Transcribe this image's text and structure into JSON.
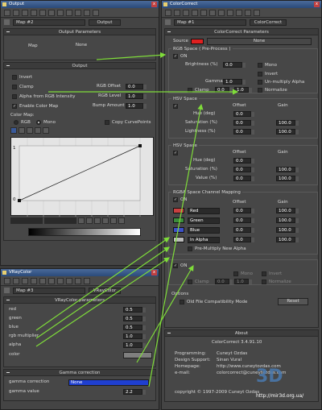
{
  "left_window": {
    "title": "Output",
    "map_name": "Map #2",
    "map_type": "Output",
    "output_params_title": "Output Parameters",
    "map_label": "Map",
    "map_value": "None",
    "output_title": "Output",
    "invert_label": "Invert",
    "clamp_label": "Clamp",
    "alpha_rgb_label": "Alpha from RGB Intensity",
    "enable_color_map_label": "Enable Color Map",
    "rgb_offset_label": "RGB Offset",
    "rgb_offset_value": "0.0",
    "rgb_level_label": "RGB Level",
    "rgb_level_value": "1.0",
    "bump_amount_label": "Bump Amount",
    "bump_amount_value": "1.0",
    "color_map_label": "Color Map:",
    "rgb_radio_label": "RGB",
    "mono_radio_label": "Mono",
    "copy_curve_label": "Copy CurvePoints",
    "curve_y_top": "1",
    "curve_y_bottom": "0"
  },
  "vray_window": {
    "title": "VRayColor",
    "map_name": "Map #3",
    "map_type": "VRayColor",
    "params_title": "VRayColor parameters",
    "red_label": "red",
    "red_value": "0.5",
    "green_label": "green",
    "green_value": "0.5",
    "blue_label": "blue",
    "blue_value": "0.5",
    "rgb_mult_label": "rgb multiplier",
    "rgb_mult_value": "1.0",
    "alpha_label": "alpha",
    "alpha_value": "1.0",
    "color_label": "color",
    "gamma_title": "Gamma correction",
    "gamma_corr_label": "gamma correction",
    "gamma_corr_value": "None",
    "gamma_value_label": "gamma value",
    "gamma_value": "2.2"
  },
  "right_window": {
    "title": "ColorCorrect",
    "map_name": "Map #1",
    "map_type": "ColorCorrect",
    "params_title": "ColorCorrect Parameters",
    "source_label": "Source",
    "source_value": "None",
    "source_color": "#e02020",
    "rgb_space_title": "RGB Space ( Pre-Process )",
    "on_label": "ON",
    "brightness_label": "Brightness (%)",
    "brightness_value": "0.0",
    "mono_label": "Mono",
    "invert_label": "Invert",
    "unmultiply_label": "Un-multiply Alpha",
    "gamma_label": "Gamma",
    "gamma_value": "1.0",
    "clamp_label": "Clamp",
    "clamp_min": "0.0",
    "clamp_max": "1.0",
    "normalize_label": "Normalize",
    "hsv_space_title": "HSV Space",
    "offset_label": "Offset",
    "gain_label": "Gain",
    "hue_label": "Hue (deg)",
    "saturation_label": "Saturation (%)",
    "lightness_label": "Lightness (%)",
    "hsv_space2_title": "HSV Space",
    "hue2_label": "Hue (deg)",
    "sat2_label": "Saturation (%)",
    "value_label": "Value (%)",
    "zero": "0.0",
    "hundred": "100.0",
    "rgba_title": "RGBA Space Channel Mapping",
    "red_opt": "Red",
    "green_opt": "Green",
    "blue_opt": "Blue",
    "alpha_opt": "In Alpha",
    "premult_label": "Pre-Multiply New Alpha",
    "post_on_label": "ON",
    "post_mono": "Mono",
    "post_invert": "Invert",
    "post_clamp": "Clamp",
    "post_normalize": "Normalize",
    "options_title": "Options",
    "old_compat_label": "Old File Compatibility Mode",
    "reset_label": "Reset",
    "about_title": "About",
    "version": "ColorCorrect 3.4.91.10",
    "programming_label": "Programming:",
    "programming_value": "Cuneyt Ozdas",
    "design_label": "Design Support:",
    "design_value": "Sinan Vural",
    "homepage_label": "Homepage:",
    "homepage_value": "http://www.cuneytozdas.com",
    "email_label": "e-mail:",
    "email_value": "colorcorrect@cuneytozdas.com",
    "copyright": "copyright © 1997-2009 Cuneyt Ozdas",
    "watermark_url": "http://mir3d.org.ua/"
  },
  "colors": {
    "arrow": "#7fdc3a",
    "source_red": "#e02020",
    "green_swatch": "#3c8c3c",
    "blue_swatch": "#3c50c8",
    "accent_blue": "#4a6a9a",
    "gamma_combo": "#1f3fd0"
  }
}
